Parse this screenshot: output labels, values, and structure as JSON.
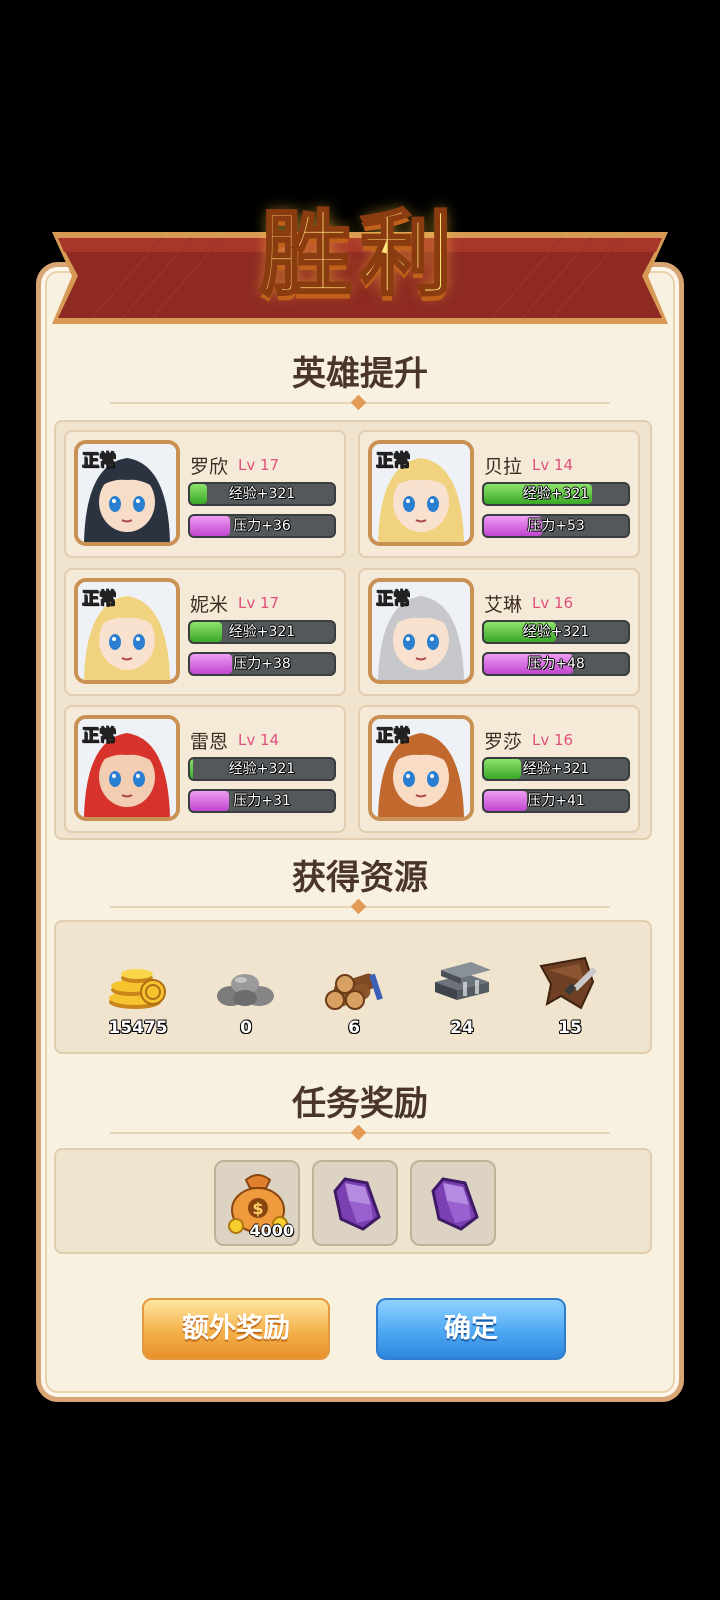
{
  "title": "胜利",
  "sections": {
    "hero_upgrade": "英雄提升",
    "resources": "获得资源",
    "quest_rewards": "任务奖励"
  },
  "heroes": [
    {
      "name": "罗欣",
      "level": "Lv 17",
      "status": "正常",
      "exp_label": "经验+321",
      "exp_fill": 0.12,
      "pressure_label": "压力+36",
      "pressure_fill": 0.28,
      "hair": "#2c3340",
      "skin": "#f7dcc7"
    },
    {
      "name": "贝拉",
      "level": "Lv 14",
      "status": "正常",
      "exp_label": "经验+321",
      "exp_fill": 0.75,
      "pressure_label": "压力+53",
      "pressure_fill": 0.4,
      "hair": "#f1d27e",
      "skin": "#f8e1cf"
    },
    {
      "name": "妮米",
      "level": "Lv 17",
      "status": "正常",
      "exp_label": "经验+321",
      "exp_fill": 0.22,
      "pressure_label": "压力+38",
      "pressure_fill": 0.29,
      "hair": "#f1d27e",
      "skin": "#f8e1cf"
    },
    {
      "name": "艾琳",
      "level": "Lv 16",
      "status": "正常",
      "exp_label": "经验+321",
      "exp_fill": 0.5,
      "pressure_label": "压力+48",
      "pressure_fill": 0.62,
      "hair": "#c7c7cc",
      "skin": "#f8e1cf"
    },
    {
      "name": "雷恩",
      "level": "Lv 14",
      "status": "正常",
      "exp_label": "经验+321",
      "exp_fill": 0.02,
      "pressure_label": "压力+31",
      "pressure_fill": 0.27,
      "hair": "#d8322c",
      "skin": "#f2cdb1"
    },
    {
      "name": "罗莎",
      "level": "Lv 16",
      "status": "正常",
      "exp_label": "经验+321",
      "exp_fill": 0.26,
      "pressure_label": "压力+41",
      "pressure_fill": 0.3,
      "hair": "#c0682e",
      "skin": "#f8dcc6"
    }
  ],
  "resources": [
    {
      "icon": "gold-coins-icon",
      "count": "15475"
    },
    {
      "icon": "stone-icon",
      "count": "0"
    },
    {
      "icon": "wood-logs-icon",
      "count": "6"
    },
    {
      "icon": "iron-bars-icon",
      "count": "24"
    },
    {
      "icon": "leather-icon",
      "count": "15"
    }
  ],
  "rewards": [
    {
      "icon": "money-bag-icon",
      "qty": "4000"
    },
    {
      "icon": "purple-crystal-icon",
      "qty": ""
    },
    {
      "icon": "purple-crystal-icon",
      "qty": ""
    }
  ],
  "buttons": {
    "extra": "额外奖励",
    "confirm": "确定"
  },
  "colors": {
    "panel_bg": "#f9f1e0",
    "panel_border": "#d9a574",
    "ribbon": "#8e2a22",
    "exp": "#3aa726",
    "pressure": "#c146cf",
    "level": "#e0507e",
    "extra_btn": "#f3b04a",
    "confirm_btn": "#4da8f3"
  }
}
